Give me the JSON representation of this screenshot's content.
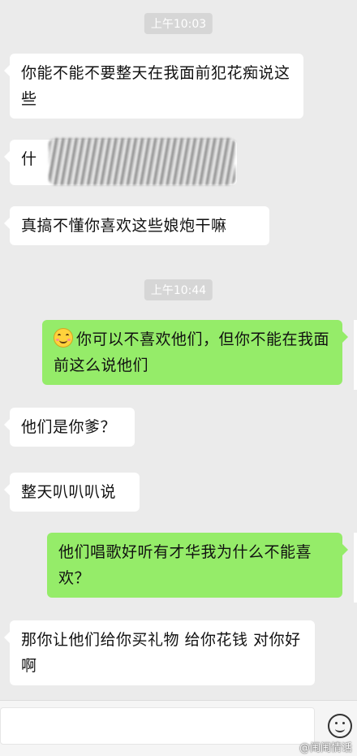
{
  "timestamps": {
    "first": "上午10:03",
    "second": "上午10:44"
  },
  "messages": [
    {
      "side": "in",
      "text": "你能不能不要整天在我面前犯花痴说这些"
    },
    {
      "side": "in",
      "text": "什",
      "redacted": true
    },
    {
      "side": "in",
      "text": "真搞不懂你喜欢这些娘炮干嘛"
    },
    {
      "side": "out",
      "text": "你可以不喜欢他们，但你不能在我面前这么说他们",
      "emoji": "smiley-blush"
    },
    {
      "side": "in",
      "text": "他们是你爹？"
    },
    {
      "side": "in",
      "text": "整天叭叭叭说"
    },
    {
      "side": "out",
      "text": "他们唱歌好听有才华我为什么不能喜欢？"
    },
    {
      "side": "in",
      "text": "那你让他们给你买礼物 给你花钱 对你好啊"
    }
  ],
  "input_bar": {
    "placeholder": "",
    "emoji_button_icon": "emoji-face-icon"
  },
  "watermark": "@闹闹情话",
  "colors": {
    "background": "#ebebeb",
    "incoming_bubble": "#ffffff",
    "outgoing_bubble": "#95ec69",
    "timestamp_bg": "#d6d6d6"
  }
}
